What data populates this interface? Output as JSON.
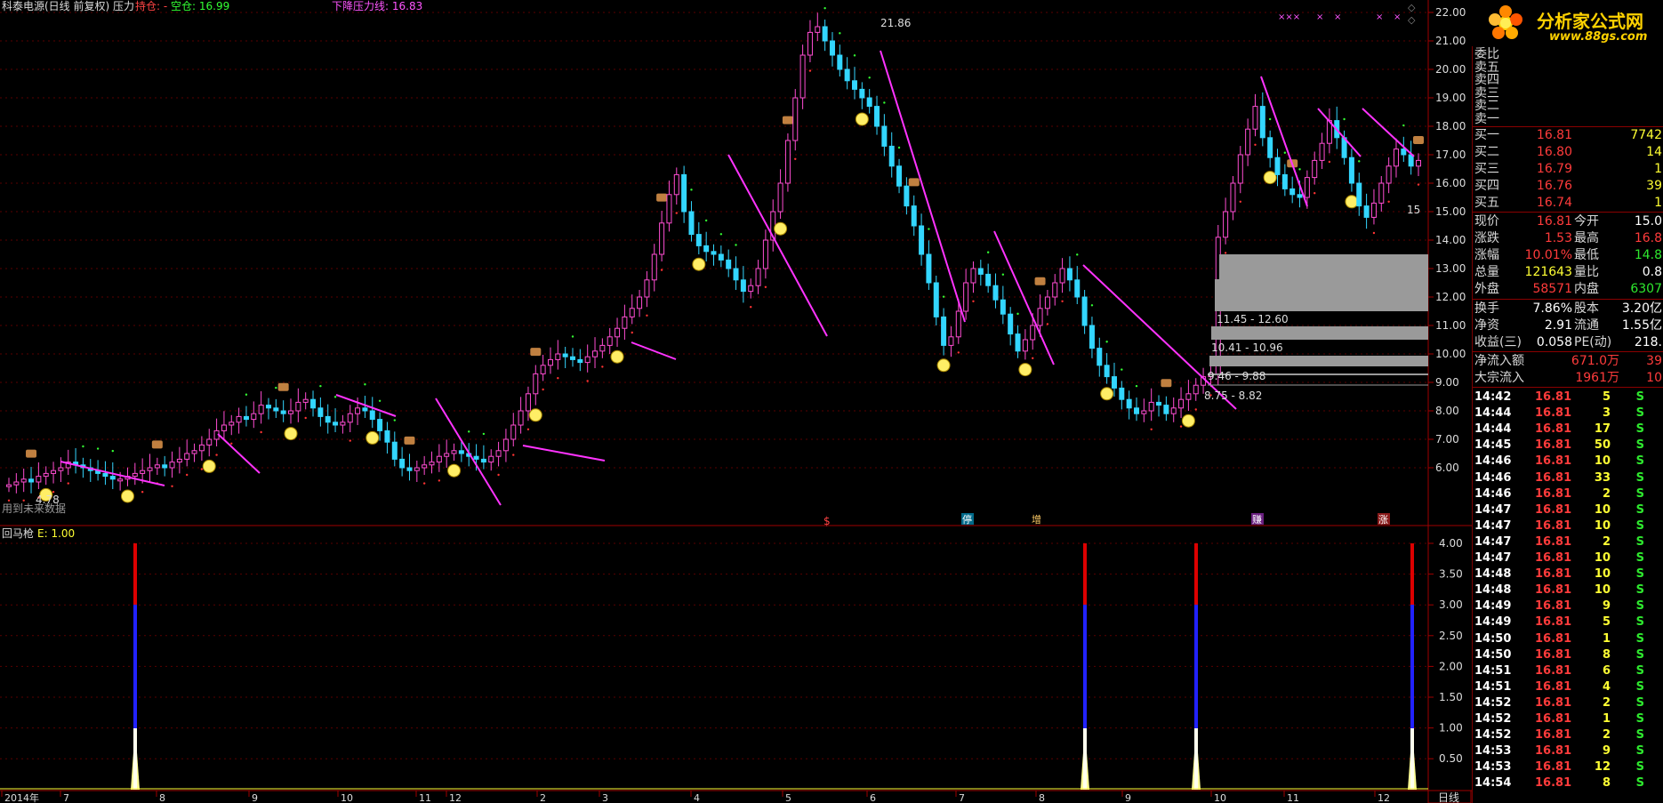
{
  "header": {
    "title": "科泰电源(日线 前复权) 压力",
    "hold_label": "持仓: -",
    "empty_label": "空仓: 16.99",
    "pressure_label": "下降压力线: 16.83",
    "marker_top": "21.86",
    "marker_bottom": "4.78",
    "future_note": "用到未来数据",
    "marker_right": "15"
  },
  "price_axis": [
    "22.00",
    "21.00",
    "20.00",
    "19.00",
    "18.00",
    "17.00",
    "16.00",
    "15.00",
    "14.00",
    "13.00",
    "12.00",
    "11.00",
    "10.00",
    "9.00",
    "8.00",
    "7.00",
    "6.00"
  ],
  "indicator": {
    "title": "回马枪",
    "value_label": "E: 1.00",
    "axis": [
      "4.00",
      "3.50",
      "3.00",
      "2.50",
      "2.00",
      "1.50",
      "1.00",
      "0.50"
    ]
  },
  "time_axis": {
    "labels": [
      "2014年",
      "7",
      "8",
      "9",
      "10",
      "11",
      "12",
      "2",
      "3",
      "4",
      "5",
      "6",
      "7",
      "8",
      "9",
      "10",
      "11",
      "12"
    ],
    "period_button": "日线"
  },
  "event_markers": [
    "$",
    "停",
    "增",
    "赚",
    "涨"
  ],
  "volume_profile": [
    "11.45 - 12.60",
    "10.41 - 10.96",
    "9.46 - 9.88",
    "8.75 - 8.82"
  ],
  "logo": {
    "text": "分析家公式网",
    "url": "www.88gs.com"
  },
  "order_book": {
    "asks": [
      {
        "label": "委比",
        "price": "",
        "vol": ""
      },
      {
        "label": "卖五",
        "price": "",
        "vol": ""
      },
      {
        "label": "卖四",
        "price": "",
        "vol": ""
      },
      {
        "label": "卖三",
        "price": "",
        "vol": ""
      },
      {
        "label": "卖二",
        "price": "",
        "vol": ""
      },
      {
        "label": "卖一",
        "price": "",
        "vol": ""
      }
    ],
    "bids": [
      {
        "label": "买一",
        "price": "16.81",
        "vol": "7742"
      },
      {
        "label": "买二",
        "price": "16.80",
        "vol": "14"
      },
      {
        "label": "买三",
        "price": "16.79",
        "vol": "1"
      },
      {
        "label": "买四",
        "price": "16.76",
        "vol": "39"
      },
      {
        "label": "买五",
        "price": "16.74",
        "vol": "1"
      }
    ]
  },
  "quote": [
    {
      "l1": "现价",
      "v1": "16.81",
      "l2": "今开",
      "v2": "15.0"
    },
    {
      "l1": "涨跌",
      "v1": "1.53",
      "l2": "最高",
      "v2": "16.8"
    },
    {
      "l1": "涨幅",
      "v1": "10.01%",
      "l2": "最低",
      "v2": "14.8"
    },
    {
      "l1": "总量",
      "v1": "121643",
      "l2": "量比",
      "v2": "0.8"
    },
    {
      "l1": "外盘",
      "v1": "58571",
      "l2": "内盘",
      "v2": "6307"
    }
  ],
  "fundamentals": [
    {
      "l1": "换手",
      "v1": "7.86%",
      "l2": "股本",
      "v2": "3.20亿"
    },
    {
      "l1": "净资",
      "v1": "2.91",
      "l2": "流通",
      "v2": "1.55亿"
    },
    {
      "l1": "收益(三)",
      "v1": "0.058",
      "l2": "PE(动)",
      "v2": "218."
    }
  ],
  "flows": [
    {
      "label": "净流入额",
      "value": "671.0万",
      "extra": "39"
    },
    {
      "label": "大宗流入",
      "value": "1961万",
      "extra": "10"
    }
  ],
  "ticks": [
    {
      "time": "14:42",
      "price": "16.81",
      "vol": "5",
      "side": "S"
    },
    {
      "time": "14:44",
      "price": "16.81",
      "vol": "3",
      "side": "S"
    },
    {
      "time": "14:44",
      "price": "16.81",
      "vol": "17",
      "side": "S"
    },
    {
      "time": "14:45",
      "price": "16.81",
      "vol": "50",
      "side": "S"
    },
    {
      "time": "14:46",
      "price": "16.81",
      "vol": "10",
      "side": "S"
    },
    {
      "time": "14:46",
      "price": "16.81",
      "vol": "33",
      "side": "S"
    },
    {
      "time": "14:46",
      "price": "16.81",
      "vol": "2",
      "side": "S"
    },
    {
      "time": "14:47",
      "price": "16.81",
      "vol": "10",
      "side": "S"
    },
    {
      "time": "14:47",
      "price": "16.81",
      "vol": "10",
      "side": "S"
    },
    {
      "time": "14:47",
      "price": "16.81",
      "vol": "2",
      "side": "S"
    },
    {
      "time": "14:47",
      "price": "16.81",
      "vol": "10",
      "side": "S"
    },
    {
      "time": "14:48",
      "price": "16.81",
      "vol": "10",
      "side": "S"
    },
    {
      "time": "14:48",
      "price": "16.81",
      "vol": "10",
      "side": "S"
    },
    {
      "time": "14:49",
      "price": "16.81",
      "vol": "9",
      "side": "S"
    },
    {
      "time": "14:49",
      "price": "16.81",
      "vol": "5",
      "side": "S"
    },
    {
      "time": "14:50",
      "price": "16.81",
      "vol": "1",
      "side": "S"
    },
    {
      "time": "14:50",
      "price": "16.81",
      "vol": "8",
      "side": "S"
    },
    {
      "time": "14:51",
      "price": "16.81",
      "vol": "6",
      "side": "S"
    },
    {
      "time": "14:51",
      "price": "16.81",
      "vol": "4",
      "side": "S"
    },
    {
      "time": "14:52",
      "price": "16.81",
      "vol": "2",
      "side": "S"
    },
    {
      "time": "14:52",
      "price": "16.81",
      "vol": "1",
      "side": "S"
    },
    {
      "time": "14:52",
      "price": "16.81",
      "vol": "2",
      "side": "S"
    },
    {
      "time": "14:53",
      "price": "16.81",
      "vol": "9",
      "side": "S"
    },
    {
      "time": "14:53",
      "price": "16.81",
      "vol": "12",
      "side": "S"
    },
    {
      "time": "14:54",
      "price": "16.81",
      "vol": "8",
      "side": "S"
    }
  ],
  "chart_data": {
    "type": "candlestick",
    "y_range": [
      5.5,
      22.2
    ],
    "closes": [
      5.4,
      5.5,
      5.6,
      5.5,
      5.7,
      5.8,
      5.9,
      6.0,
      6.2,
      6.1,
      6.0,
      5.9,
      5.8,
      5.7,
      5.6,
      5.6,
      5.7,
      5.8,
      5.9,
      6.0,
      6.1,
      6.0,
      6.2,
      6.3,
      6.5,
      6.6,
      6.8,
      7.0,
      7.3,
      7.5,
      7.6,
      7.8,
      7.7,
      7.9,
      8.2,
      8.1,
      8.0,
      7.9,
      8.0,
      8.3,
      8.4,
      8.1,
      7.8,
      7.6,
      7.5,
      7.6,
      7.9,
      8.1,
      8.0,
      7.7,
      7.3,
      6.9,
      6.3,
      6.0,
      5.9,
      6.0,
      6.1,
      6.2,
      6.4,
      6.5,
      6.6,
      6.5,
      6.4,
      6.3,
      6.2,
      6.4,
      6.6,
      7.0,
      7.5,
      8.0,
      8.6,
      9.3,
      9.6,
      9.8,
      10.0,
      9.9,
      9.8,
      9.7,
      9.9,
      10.1,
      10.3,
      10.6,
      10.9,
      11.3,
      11.6,
      12.0,
      12.6,
      13.5,
      14.6,
      15.6,
      16.3,
      15.0,
      14.2,
      13.8,
      13.6,
      13.5,
      13.3,
      13.0,
      12.6,
      12.2,
      12.4,
      13.0,
      14.0,
      15.0,
      16.0,
      17.5,
      19.0,
      20.5,
      21.3,
      21.5,
      21.0,
      20.5,
      20.0,
      19.6,
      19.3,
      19.0,
      18.7,
      18.0,
      17.3,
      16.6,
      15.9,
      15.2,
      14.5,
      13.5,
      12.5,
      11.3,
      10.3,
      10.6,
      11.5,
      12.5,
      13.0,
      12.8,
      12.4,
      11.9,
      11.4,
      10.7,
      10.1,
      10.5,
      11.0,
      11.6,
      12.0,
      12.5,
      13.0,
      12.6,
      12.0,
      11.0,
      10.2,
      9.6,
      9.2,
      8.8,
      8.4,
      8.1,
      7.9,
      8.0,
      8.3,
      8.2,
      7.9,
      8.1,
      8.4,
      8.6,
      8.9,
      9.2,
      9.3,
      14.1,
      15.0,
      16.0,
      17.0,
      17.9,
      18.7,
      17.6,
      16.9,
      16.3,
      15.8,
      15.6,
      15.5,
      16.2,
      16.8,
      17.4,
      18.2,
      17.6,
      16.9,
      16.0,
      15.2,
      14.8,
      15.3,
      16.0,
      16.6,
      17.2,
      17.0,
      16.6,
      16.8
    ]
  }
}
